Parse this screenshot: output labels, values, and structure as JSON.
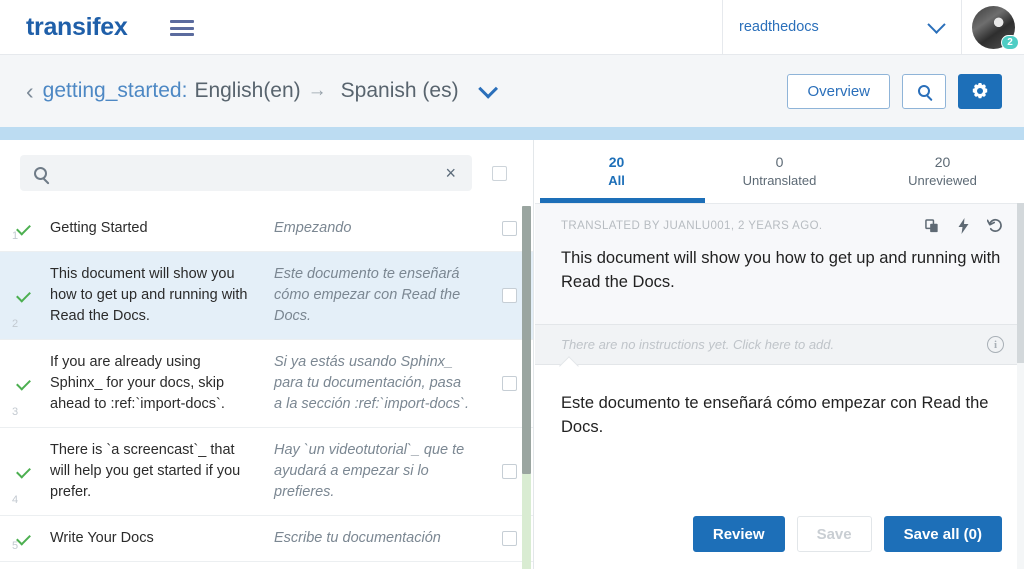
{
  "topbar": {
    "brand": "transifex",
    "menu_icon": "hamburger-icon",
    "organization": "readthedocs",
    "org_chevron_icon": "chevron-down-icon",
    "avatar_badge": "2"
  },
  "subheader": {
    "back_icon": "‹",
    "resource": "getting_started:",
    "source_language": "English(en)",
    "arrow": "→",
    "target_language": "Spanish (es)",
    "lang_chevron_icon": "chevron-down-icon",
    "overview_label": "Overview",
    "search_icon": "search-icon",
    "settings_icon": "gear-icon"
  },
  "search": {
    "value": "",
    "placeholder": "",
    "icon": "search-icon",
    "clear_icon": "×"
  },
  "tabs": [
    {
      "count": "20",
      "label": "All",
      "active": true
    },
    {
      "count": "0",
      "label": "Untranslated",
      "active": false
    },
    {
      "count": "20",
      "label": "Unreviewed",
      "active": false
    }
  ],
  "strings": [
    {
      "num": "1",
      "source": "Getting Started",
      "target": "Empezando",
      "status": "translated",
      "selected": false
    },
    {
      "num": "2",
      "source": "This document will show you how to get up and running with Read the Docs.",
      "target": "Este documento te enseñará cómo empezar con Read the Docs.",
      "status": "translated",
      "selected": true
    },
    {
      "num": "3",
      "source": "If you are already using Sphinx_ for your docs, skip ahead to :ref:`import-docs`.",
      "target": "Si ya estás usando Sphinx_ para tu documentación, pasa a la sección :ref:`import-docs`.",
      "status": "translated",
      "selected": false
    },
    {
      "num": "4",
      "source": "There is `a screencast`_ that will help you get started if you prefer.",
      "target": "Hay `un videotutorial`_ que te ayudará a empezar si lo prefieres.",
      "status": "translated",
      "selected": false
    },
    {
      "num": "5",
      "source": "Write Your Docs",
      "target": "Escribe tu documentación",
      "status": "translated",
      "selected": false
    }
  ],
  "editor": {
    "meta": "TRANSLATED BY JUANLU001, 2 YEARS AGO.",
    "copy_icon": "copy-icon",
    "mt_icon": "lightning-icon",
    "undo_icon": "undo-icon",
    "source_text": "This document will show you how to get up and running with Read the Docs.",
    "instructions_placeholder": "There are no instructions yet. Click here to add.",
    "info_icon": "info-icon",
    "target_text": "Este documento te enseñará cómo empezar con Read the Docs.",
    "review_label": "Review",
    "save_label": "Save",
    "save_all_label": "Save all (0)"
  },
  "colors": {
    "brand_blue": "#1f5fa9",
    "primary_blue": "#1d6fb8",
    "link_blue": "#4d88c4",
    "selected_row": "#e4eff8",
    "strip_blue": "#bcdcf2",
    "check_green": "#4caf50",
    "badge_teal": "#4ecdc4"
  }
}
